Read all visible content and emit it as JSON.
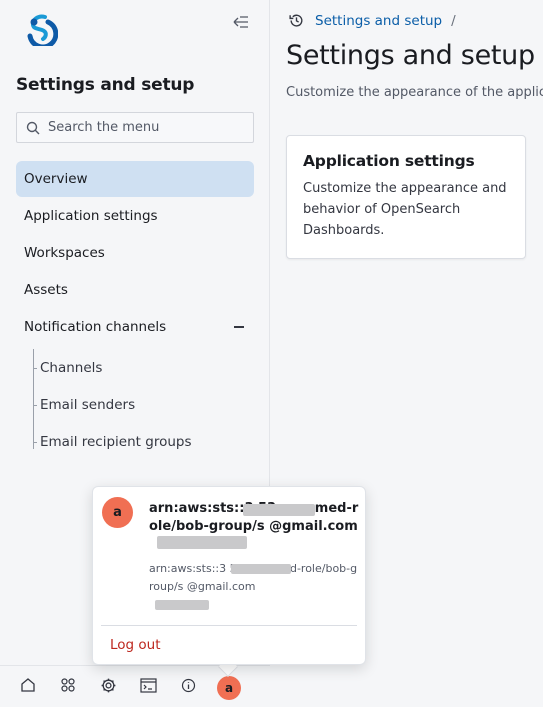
{
  "sidebar": {
    "title": "Settings and setup",
    "search_placeholder": "Search the menu",
    "items": [
      {
        "label": "Overview"
      },
      {
        "label": "Application settings"
      },
      {
        "label": "Workspaces"
      },
      {
        "label": "Assets"
      },
      {
        "label": "Notification channels"
      }
    ],
    "sub_items": [
      {
        "label": "Channels"
      },
      {
        "label": "Email senders"
      },
      {
        "label": "Email recipient groups"
      }
    ],
    "bottom_icons": [
      "home-icon",
      "apps-icon",
      "gear-icon",
      "console-icon",
      "info-icon"
    ],
    "avatar_letter": "a"
  },
  "header": {
    "breadcrumb": "Settings and setup",
    "breadcrumb_sep": "/",
    "title": "Settings and setup o",
    "description": "Customize the appearance of the applic"
  },
  "card": {
    "title": "Application settings",
    "description": "Customize the appearance and behavior of OpenSearch Dashboards."
  },
  "user_popover": {
    "avatar_letter": "a",
    "name": "arn:aws:sts::3              53:assumed-role/bob-group/s               @gmail.com",
    "detail": "arn:aws:sts::3                     53:assumed-role/bob-group/s               @gmail.com",
    "logout_label": "Log out"
  },
  "colors": {
    "accent": "#0b5ea8",
    "active_bg": "#cfe0f2",
    "avatar": "#f06f53",
    "danger": "#bd271e"
  }
}
